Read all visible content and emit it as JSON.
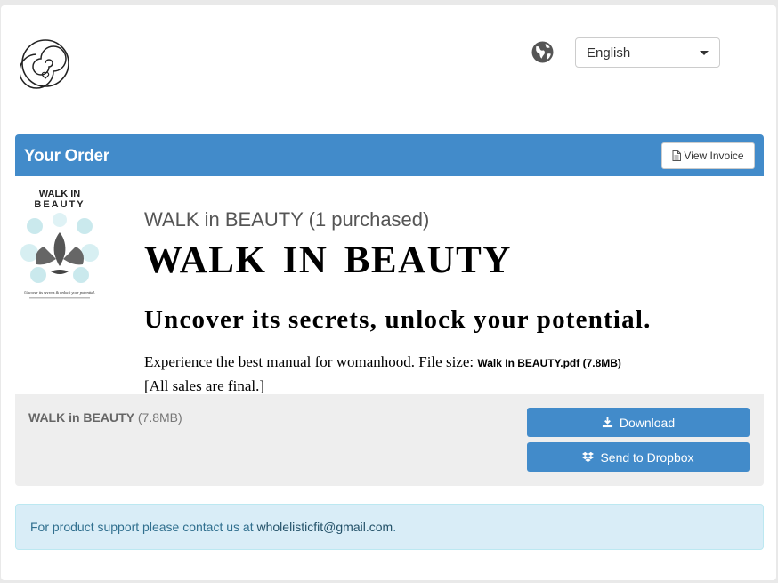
{
  "header": {
    "logo_icon": "spiral-heart-logo",
    "globe_icon": "globe-icon",
    "language": {
      "selected": "English"
    }
  },
  "order": {
    "title": "Your Order",
    "view_invoice_label": "View Invoice",
    "product": {
      "purchased_title": "WALK in BEAUTY (1 purchased)",
      "hero_title": "WALK IN BEAUTY",
      "tagline": "Uncover its secrets, unlock your potential.",
      "description": "Experience the best manual for womanhood. File size: ",
      "file_name_size": "Walk In BEAUTY.pdf (7.8MB)",
      "final_note": "[All sales are final.]",
      "cover": {
        "title_line1": "WALK IN",
        "title_line2": "BEAUTY",
        "subtitle": "Uncover its secrets & unlock your potential."
      }
    },
    "download": {
      "file_name": "WALK in BEAUTY",
      "file_size": " (7.8MB)",
      "download_label": "Download",
      "dropbox_label": "Send to Dropbox"
    }
  },
  "support": {
    "text": "For product support please contact us at ",
    "email": "wholelisticfit@gmail.com",
    "suffix": "."
  },
  "colors": {
    "primary": "#428bca",
    "info_bg": "#d9edf7",
    "panel_bg": "#eeeeee"
  }
}
